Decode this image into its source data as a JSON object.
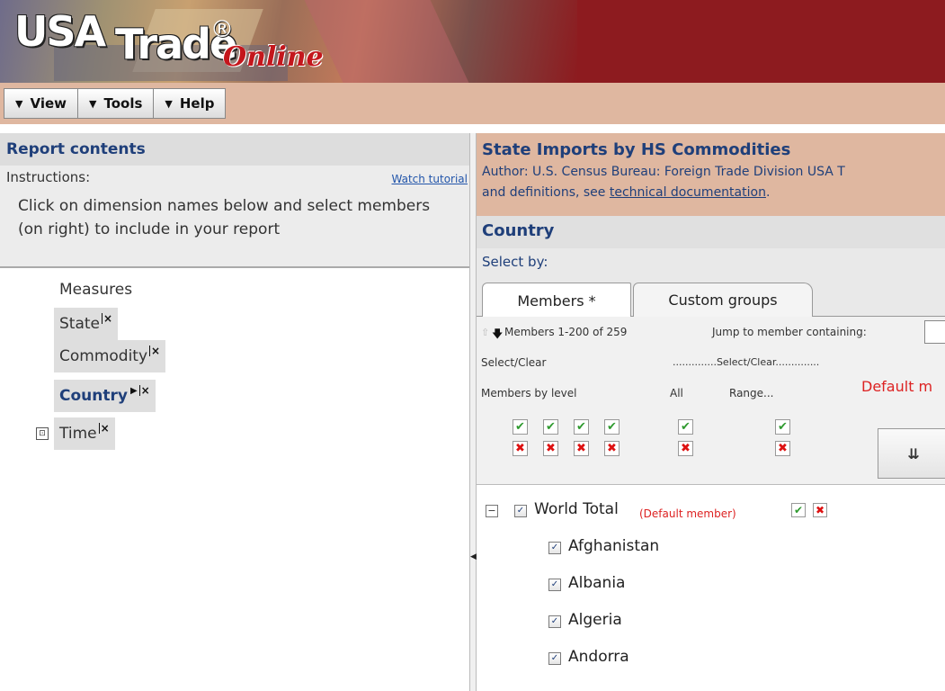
{
  "header": {
    "logo_usa": "USA",
    "logo_trade": "Trade",
    "logo_reg": "®",
    "logo_online": "Online",
    "colors": {
      "banner": "#8d1b1f",
      "menubar": "#dfb7a0"
    }
  },
  "menu": {
    "items": [
      {
        "label": "View",
        "icon": "triangle-down-icon"
      },
      {
        "label": "Tools",
        "icon": "triangle-down-icon"
      },
      {
        "label": "Help",
        "icon": "triangle-down-icon"
      }
    ]
  },
  "left": {
    "title": "Report contents",
    "instructions_label": "Instructions:",
    "watch_tutorial": "Watch tutorial",
    "instructions_text": "Click on dimension names below and select members (on right) to include in your report",
    "dimensions": [
      {
        "label": "Measures"
      },
      {
        "label": "State"
      },
      {
        "label": "Commodity"
      },
      {
        "label": "Country"
      },
      {
        "label": "Time"
      }
    ]
  },
  "right": {
    "report_title": "State Imports by HS Commodities",
    "author": "Author: U.S. Census Bureau: Foreign Trade Division USA T",
    "defs_prefix": "and definitions, see ",
    "defs_link": "technical documentation",
    "defs_suffix": ".",
    "section_title": "Country",
    "select_by": "Select by:",
    "tabs": {
      "members": "Members *",
      "custom_groups": "Custom groups"
    },
    "members_panel": {
      "range": "Members 1-200 of 259",
      "jump_label": "Jump to member containing:",
      "select_clear": "Select/Clear",
      "select_clear_dotted": "..............Select/Clear..............",
      "members_by_level": "Members by level",
      "all": "All",
      "range_label": "Range...",
      "default_label": "Default m"
    },
    "member_list": {
      "world_total": "World Total",
      "default_tag": "(Default member)",
      "countries": [
        "Afghanistan",
        "Albania",
        "Algeria",
        "Andorra"
      ]
    }
  }
}
